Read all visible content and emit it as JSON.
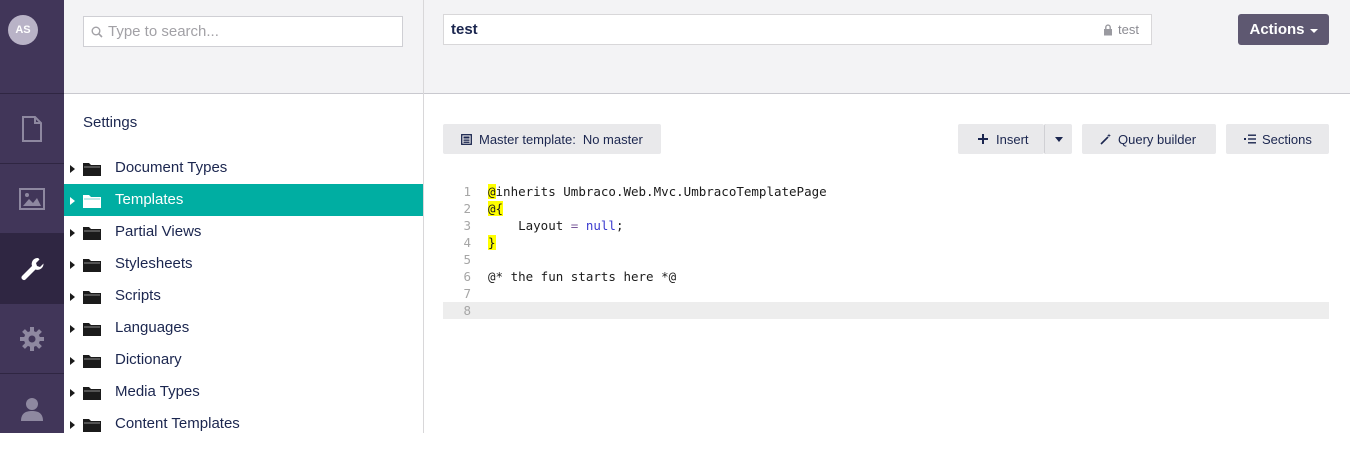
{
  "user": {
    "initials": "AS"
  },
  "rail": {
    "items": [
      {
        "icon": "document-icon",
        "active": false
      },
      {
        "icon": "image-icon",
        "active": false
      },
      {
        "icon": "wrench-icon",
        "active": true
      },
      {
        "icon": "gear-icon",
        "active": false
      },
      {
        "icon": "user-icon",
        "active": false
      }
    ]
  },
  "tree": {
    "search_placeholder": "Type to search...",
    "title": "Settings",
    "items": [
      {
        "label": "Document Types"
      },
      {
        "label": "Templates"
      },
      {
        "label": "Partial Views"
      },
      {
        "label": "Stylesheets"
      },
      {
        "label": "Scripts"
      },
      {
        "label": "Languages"
      },
      {
        "label": "Dictionary"
      },
      {
        "label": "Media Types"
      },
      {
        "label": "Content Templates"
      }
    ],
    "active_item": "Templates"
  },
  "editor": {
    "name_value": "test",
    "alias": "test",
    "actions_label": "Actions",
    "master_template_label": "Master template:",
    "master_template_value": "No master",
    "insert_label": "Insert",
    "query_builder_label": "Query builder",
    "sections_label": "Sections",
    "code": {
      "line_numbers": [
        "1",
        "2",
        "3",
        "4",
        "5",
        "6",
        "7",
        "8"
      ],
      "l1_at": "@",
      "l1_rest": "inherits Umbraco.Web.Mvc.UmbracoTemplatePage",
      "l2": "@{",
      "l3_indent": "    Layout ",
      "l3_eq": "=",
      "l3_null": "null",
      "l3_semi": ";",
      "l4": "}",
      "l6_comment": "@* the fun starts here *@"
    }
  },
  "colors": {
    "rail": "#413659",
    "rail_active": "#2f2642",
    "tree_active": "#00aea2",
    "actions_button": "#5e5871"
  }
}
